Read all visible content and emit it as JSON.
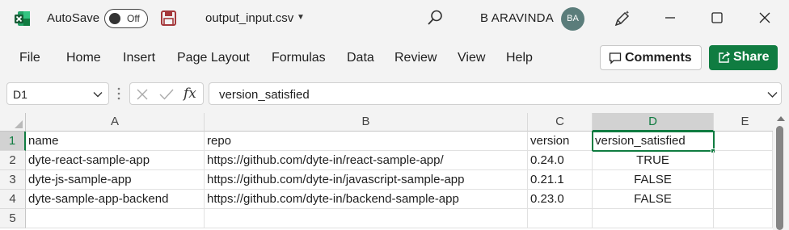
{
  "titlebar": {
    "autosave_label": "AutoSave",
    "autosave_state": "Off",
    "filename": "output_input.csv",
    "user_name": "B ARAVINDA",
    "avatar_initials": "BA"
  },
  "ribbon": {
    "tabs": [
      "File",
      "Home",
      "Insert",
      "Page Layout",
      "Formulas",
      "Data",
      "Review",
      "View",
      "Help"
    ],
    "comments_label": "Comments",
    "share_label": "Share"
  },
  "formula_bar": {
    "name_box": "D1",
    "fx_label": "fx",
    "content": "version_satisfied"
  },
  "sheet": {
    "columns": [
      "A",
      "B",
      "C",
      "D",
      "E"
    ],
    "selected_column": "D",
    "selected_row": "1",
    "rows": [
      {
        "num": "1",
        "cells": [
          "name",
          "repo",
          "version",
          "version_satisfied",
          ""
        ]
      },
      {
        "num": "2",
        "cells": [
          "dyte-react-sample-app",
          "https://github.com/dyte-in/react-sample-app/",
          "0.24.0",
          "TRUE",
          ""
        ]
      },
      {
        "num": "3",
        "cells": [
          "dyte-js-sample-app",
          "https://github.com/dyte-in/javascript-sample-app",
          "0.21.1",
          "FALSE",
          ""
        ]
      },
      {
        "num": "4",
        "cells": [
          "dyte-sample-app-backend",
          "https://github.com/dyte-in/backend-sample-app",
          "0.23.0",
          "FALSE",
          ""
        ]
      },
      {
        "num": "5",
        "cells": [
          "",
          "",
          "",
          "",
          ""
        ]
      }
    ]
  },
  "colors": {
    "excel_green": "#107c41",
    "avatar_bg": "#5b7d7b",
    "save_icon": "#a4373a"
  }
}
